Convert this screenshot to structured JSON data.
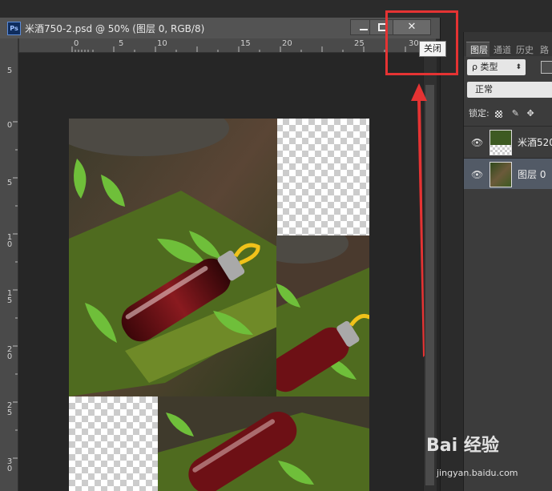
{
  "document": {
    "app_icon_text": "Ps",
    "title": "米酒750-2.psd @ 50% (图层 0, RGB/8)",
    "close_symbol": "✕",
    "close_tooltip": "关闭"
  },
  "ruler_top": [
    "0",
    "5",
    "10",
    "15",
    "20",
    "25",
    "30"
  ],
  "ruler_left": [
    "5",
    "0",
    "5",
    "10",
    "15",
    "20",
    "25",
    "30"
  ],
  "layers_panel": {
    "tabs": [
      "图层",
      "通道",
      "历史",
      "路"
    ],
    "filter_label": "ρ 类型",
    "blend_mode": "正常",
    "lock_label": "锁定:",
    "layers": [
      {
        "name": "米酒520",
        "visible": true,
        "selected": false
      },
      {
        "name": "图层 0",
        "visible": true,
        "selected": true
      }
    ]
  },
  "watermark": {
    "brand": "Bai 经验",
    "url": "jingyan.baidu.com"
  },
  "colors": {
    "highlight": "#e53333",
    "panel_bg": "#3c3c3c",
    "selected_layer": "#525a66"
  }
}
